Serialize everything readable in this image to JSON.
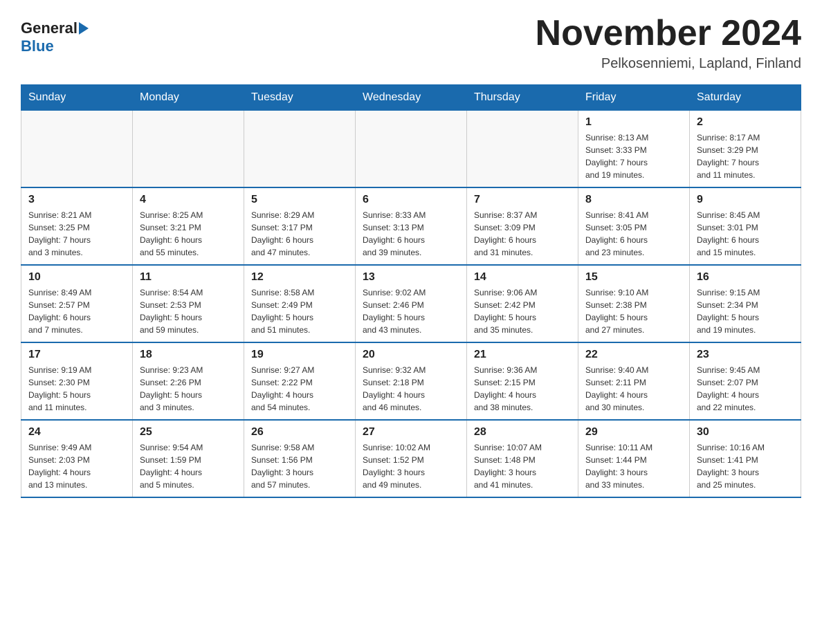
{
  "header": {
    "logo_general": "General",
    "logo_blue": "Blue",
    "month_title": "November 2024",
    "location": "Pelkosenniemi, Lapland, Finland"
  },
  "weekdays": [
    "Sunday",
    "Monday",
    "Tuesday",
    "Wednesday",
    "Thursday",
    "Friday",
    "Saturday"
  ],
  "weeks": [
    [
      {
        "day": "",
        "info": ""
      },
      {
        "day": "",
        "info": ""
      },
      {
        "day": "",
        "info": ""
      },
      {
        "day": "",
        "info": ""
      },
      {
        "day": "",
        "info": ""
      },
      {
        "day": "1",
        "info": "Sunrise: 8:13 AM\nSunset: 3:33 PM\nDaylight: 7 hours\nand 19 minutes."
      },
      {
        "day": "2",
        "info": "Sunrise: 8:17 AM\nSunset: 3:29 PM\nDaylight: 7 hours\nand 11 minutes."
      }
    ],
    [
      {
        "day": "3",
        "info": "Sunrise: 8:21 AM\nSunset: 3:25 PM\nDaylight: 7 hours\nand 3 minutes."
      },
      {
        "day": "4",
        "info": "Sunrise: 8:25 AM\nSunset: 3:21 PM\nDaylight: 6 hours\nand 55 minutes."
      },
      {
        "day": "5",
        "info": "Sunrise: 8:29 AM\nSunset: 3:17 PM\nDaylight: 6 hours\nand 47 minutes."
      },
      {
        "day": "6",
        "info": "Sunrise: 8:33 AM\nSunset: 3:13 PM\nDaylight: 6 hours\nand 39 minutes."
      },
      {
        "day": "7",
        "info": "Sunrise: 8:37 AM\nSunset: 3:09 PM\nDaylight: 6 hours\nand 31 minutes."
      },
      {
        "day": "8",
        "info": "Sunrise: 8:41 AM\nSunset: 3:05 PM\nDaylight: 6 hours\nand 23 minutes."
      },
      {
        "day": "9",
        "info": "Sunrise: 8:45 AM\nSunset: 3:01 PM\nDaylight: 6 hours\nand 15 minutes."
      }
    ],
    [
      {
        "day": "10",
        "info": "Sunrise: 8:49 AM\nSunset: 2:57 PM\nDaylight: 6 hours\nand 7 minutes."
      },
      {
        "day": "11",
        "info": "Sunrise: 8:54 AM\nSunset: 2:53 PM\nDaylight: 5 hours\nand 59 minutes."
      },
      {
        "day": "12",
        "info": "Sunrise: 8:58 AM\nSunset: 2:49 PM\nDaylight: 5 hours\nand 51 minutes."
      },
      {
        "day": "13",
        "info": "Sunrise: 9:02 AM\nSunset: 2:46 PM\nDaylight: 5 hours\nand 43 minutes."
      },
      {
        "day": "14",
        "info": "Sunrise: 9:06 AM\nSunset: 2:42 PM\nDaylight: 5 hours\nand 35 minutes."
      },
      {
        "day": "15",
        "info": "Sunrise: 9:10 AM\nSunset: 2:38 PM\nDaylight: 5 hours\nand 27 minutes."
      },
      {
        "day": "16",
        "info": "Sunrise: 9:15 AM\nSunset: 2:34 PM\nDaylight: 5 hours\nand 19 minutes."
      }
    ],
    [
      {
        "day": "17",
        "info": "Sunrise: 9:19 AM\nSunset: 2:30 PM\nDaylight: 5 hours\nand 11 minutes."
      },
      {
        "day": "18",
        "info": "Sunrise: 9:23 AM\nSunset: 2:26 PM\nDaylight: 5 hours\nand 3 minutes."
      },
      {
        "day": "19",
        "info": "Sunrise: 9:27 AM\nSunset: 2:22 PM\nDaylight: 4 hours\nand 54 minutes."
      },
      {
        "day": "20",
        "info": "Sunrise: 9:32 AM\nSunset: 2:18 PM\nDaylight: 4 hours\nand 46 minutes."
      },
      {
        "day": "21",
        "info": "Sunrise: 9:36 AM\nSunset: 2:15 PM\nDaylight: 4 hours\nand 38 minutes."
      },
      {
        "day": "22",
        "info": "Sunrise: 9:40 AM\nSunset: 2:11 PM\nDaylight: 4 hours\nand 30 minutes."
      },
      {
        "day": "23",
        "info": "Sunrise: 9:45 AM\nSunset: 2:07 PM\nDaylight: 4 hours\nand 22 minutes."
      }
    ],
    [
      {
        "day": "24",
        "info": "Sunrise: 9:49 AM\nSunset: 2:03 PM\nDaylight: 4 hours\nand 13 minutes."
      },
      {
        "day": "25",
        "info": "Sunrise: 9:54 AM\nSunset: 1:59 PM\nDaylight: 4 hours\nand 5 minutes."
      },
      {
        "day": "26",
        "info": "Sunrise: 9:58 AM\nSunset: 1:56 PM\nDaylight: 3 hours\nand 57 minutes."
      },
      {
        "day": "27",
        "info": "Sunrise: 10:02 AM\nSunset: 1:52 PM\nDaylight: 3 hours\nand 49 minutes."
      },
      {
        "day": "28",
        "info": "Sunrise: 10:07 AM\nSunset: 1:48 PM\nDaylight: 3 hours\nand 41 minutes."
      },
      {
        "day": "29",
        "info": "Sunrise: 10:11 AM\nSunset: 1:44 PM\nDaylight: 3 hours\nand 33 minutes."
      },
      {
        "day": "30",
        "info": "Sunrise: 10:16 AM\nSunset: 1:41 PM\nDaylight: 3 hours\nand 25 minutes."
      }
    ]
  ]
}
